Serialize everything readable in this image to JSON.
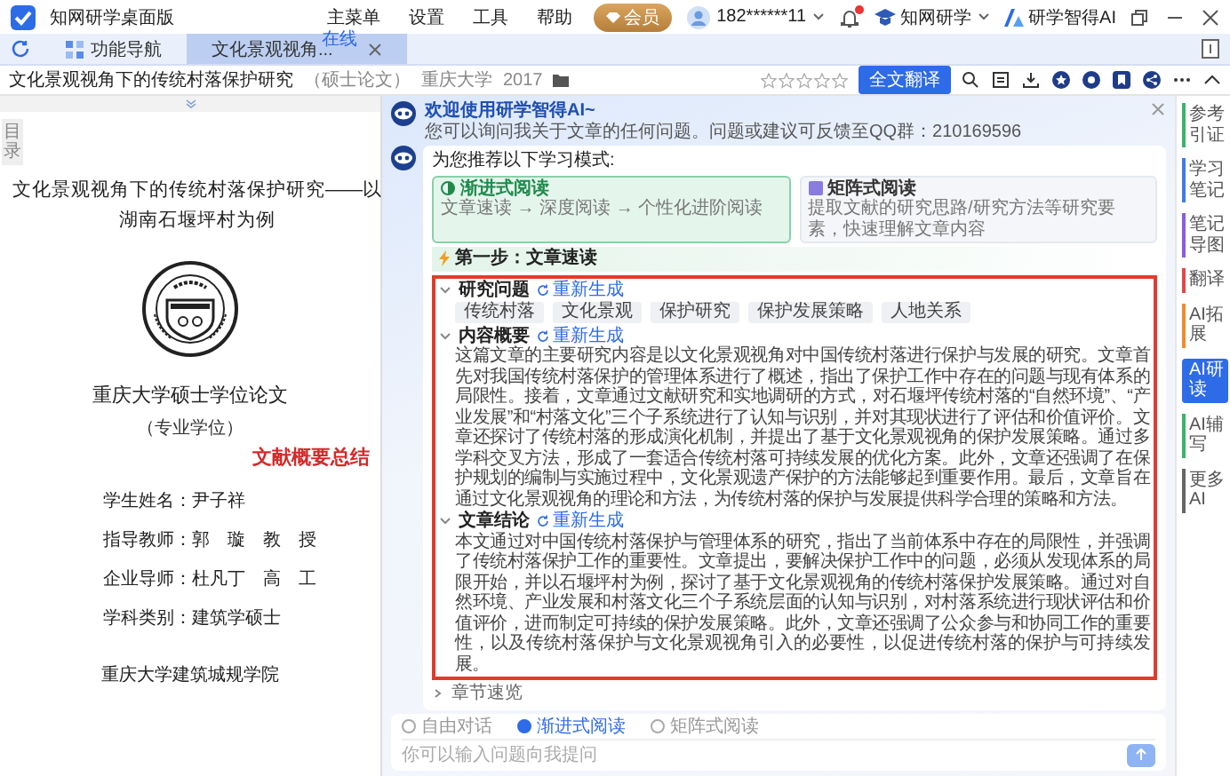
{
  "app": {
    "title": "知网研学桌面版",
    "menu": [
      "主菜单",
      "设置",
      "工具",
      "帮助"
    ],
    "vip": "会员",
    "user": "182******11",
    "bell_badge": true,
    "brand": "知网研学",
    "ai_brand": "研学智得AI"
  },
  "tabs": [
    {
      "label": "功能导航",
      "selected": false
    },
    {
      "label": "文化景观视角...",
      "selected": true,
      "badge": "在线"
    }
  ],
  "doc_bar": {
    "title": "文化景观视角下的传统村落保护研究",
    "type": "（硕士论文）",
    "school": "重庆大学",
    "year": "2017",
    "stars": 0,
    "translate": "全文翻译"
  },
  "document": {
    "toc": "目录",
    "title": [
      "文化景观视角下的传统村落保护研究——以",
      "湖南石堰坪村为例"
    ],
    "degree": "重庆大学硕士学位论文",
    "degree_type": "（专业学位）",
    "annotation": "文献概要总结",
    "info": [
      {
        "label": "学生姓名：",
        "value": "尹子祥"
      },
      {
        "label": "指导教师：",
        "value": "郭　璇　教　授"
      },
      {
        "label": "企业导师：",
        "value": "杜凡丁　高　工"
      },
      {
        "label": "学科类别：",
        "value": "建筑学硕士"
      }
    ],
    "footer": "重庆大学建筑城规学院"
  },
  "assistant": {
    "welcome": "欢迎使用研学智得AI~",
    "intro": "您可以询问我关于文章的任何问题。问题或建议可反馈至QQ群：210169596",
    "recommend": "为您推荐以下学习模式:",
    "modes": [
      {
        "title": "渐进式阅读",
        "desc": "文章速读 → 深度阅读 → 个性化进阶阅读",
        "selected": true
      },
      {
        "title": "矩阵式阅读",
        "desc": "提取文献的研究思路/研究方法等研究要素，快速理解文章内容",
        "selected": false
      }
    ],
    "step": "第一步：文章速读",
    "sections": [
      {
        "kind": "tags",
        "title": "研究问题",
        "regen": "重新生成",
        "expanded": true,
        "tags": [
          "传统村落",
          "文化景观",
          "保护研究",
          "保护发展策略",
          "人地关系"
        ]
      },
      {
        "kind": "text",
        "title": "内容概要",
        "regen": "重新生成",
        "expanded": true,
        "text": "这篇文章的主要研究内容是以文化景观视角对中国传统村落进行保护与发展的研究。文章首先对我国传统村落保护的管理体系进行了概述，指出了保护工作中存在的问题与现有体系的局限性。接着，文章通过文献研究和实地调研的方式，对石堰坪传统村落的“自然环境”、“产业发展”和“村落文化”三个子系统进行了认知与识别，并对其现状进行了评估和价值评价。文章还探讨了传统村落的形成演化机制，并提出了基于文化景观视角的保护发展策略。通过多学科交叉方法，形成了一套适合传统村落可持续发展的优化方案。此外，文章还强调了在保护规划的编制与实施过程中，文化景观遗产保护的方法能够起到重要作用。最后，文章旨在通过文化景观视角的理论和方法，为传统村落的保护与发展提供科学合理的策略和方法。"
      },
      {
        "kind": "text",
        "title": "文章结论",
        "regen": "重新生成",
        "expanded": true,
        "text": "本文通过对中国传统村落保护与管理体系的研究，指出了当前体系中存在的局限性，并强调了传统村落保护工作的重要性。文章提出，要解决保护工作中的问题，必须从发现体系的局限开始，并以石堰坪村为例，探讨了基于文化景观视角的传统村落保护发展策略。通过对自然环境、产业发展和村落文化三个子系统层面的认知与识别，对村落系统进行现状评估和价值评价，进而制定可持续的保护发展策略。此外，文章还强调了公众参与和协同工作的重要性，以及传统村落保护与文化景观视角引入的必要性，以促进传统村落的保护与可持续发展。"
      },
      {
        "kind": "title",
        "title": "章节速览",
        "expanded": false
      }
    ],
    "input_modes": [
      {
        "label": "自由对话",
        "selected": false
      },
      {
        "label": "渐进式阅读",
        "selected": true
      },
      {
        "label": "矩阵式阅读",
        "selected": false
      }
    ],
    "input": {
      "placeholder": "你可以输入问题向我提问"
    }
  },
  "tools": [
    {
      "label": "参考引证",
      "color": "#3bb36b",
      "selected": false
    },
    {
      "label": "学习笔记",
      "color": "#3f7be8",
      "selected": false
    },
    {
      "label": "笔记导图",
      "color": "#8a5be0",
      "selected": false
    },
    {
      "label": "翻译",
      "color": "#e04848",
      "selected": false
    },
    {
      "label": "AI拓展",
      "color": "#f08a30",
      "selected": false
    },
    {
      "label": "AI研读",
      "color": "#2f6de8",
      "selected": true
    },
    {
      "label": "AI辅写",
      "color": "#3bb36b",
      "selected": false
    },
    {
      "label": "更多AI",
      "color": "#666666",
      "selected": false
    }
  ]
}
